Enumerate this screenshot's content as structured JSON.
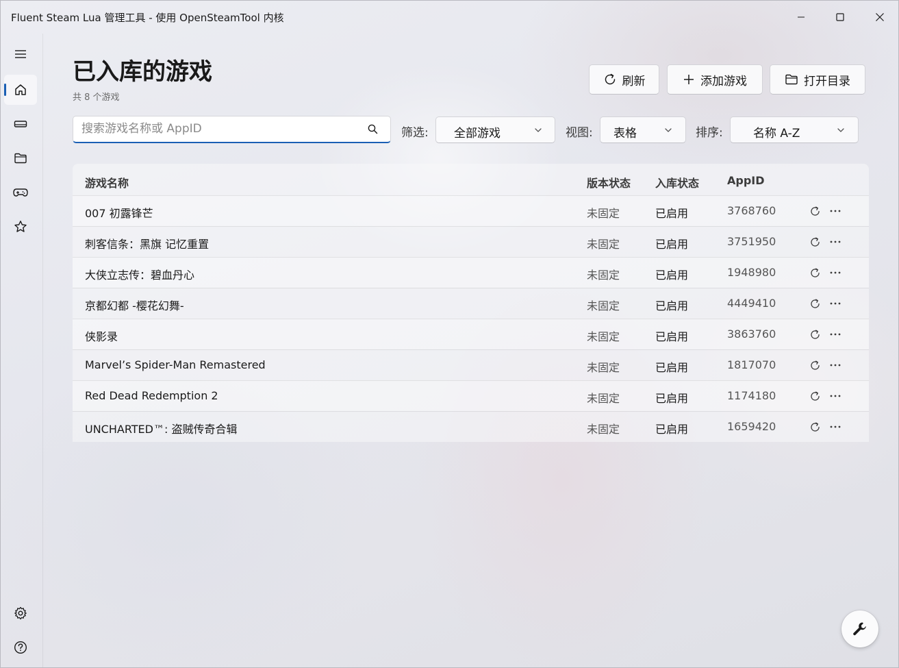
{
  "window": {
    "title": "Fluent Steam Lua 管理工具 - 使用 OpenSteamTool 内核"
  },
  "header": {
    "title": "已入库的游戏",
    "subtitle": "共 8 个游戏",
    "buttons": {
      "refresh": "刷新",
      "add_game": "添加游戏",
      "open_dir": "打开目录"
    }
  },
  "filters": {
    "search_placeholder": "搜索游戏名称或 AppID",
    "filter_label": "筛选:",
    "filter_value": "全部游戏",
    "view_label": "视图:",
    "view_value": "表格",
    "sort_label": "排序:",
    "sort_value": "名称 A-Z"
  },
  "table": {
    "columns": {
      "name": "游戏名称",
      "version": "版本状态",
      "status": "入库状态",
      "appid": "AppID"
    },
    "rows": [
      {
        "name": "007 初露锋芒",
        "version": "未固定",
        "status": "已启用",
        "appid": "3768760"
      },
      {
        "name": "刺客信条：黑旗 记忆重置",
        "version": "未固定",
        "status": "已启用",
        "appid": "3751950"
      },
      {
        "name": "大侠立志传：碧血丹心",
        "version": "未固定",
        "status": "已启用",
        "appid": "1948980"
      },
      {
        "name": "京都幻都 -樱花幻舞-",
        "version": "未固定",
        "status": "已启用",
        "appid": "4449410"
      },
      {
        "name": "侠影录",
        "version": "未固定",
        "status": "已启用",
        "appid": "3863760"
      },
      {
        "name": "Marvel’s Spider-Man Remastered",
        "version": "未固定",
        "status": "已启用",
        "appid": "1817070"
      },
      {
        "name": "Red Dead Redemption 2",
        "version": "未固定",
        "status": "已启用",
        "appid": "1174180"
      },
      {
        "name": "UNCHARTED™: 盗贼传奇合辑",
        "version": "未固定",
        "status": "已启用",
        "appid": "1659420"
      }
    ]
  },
  "icons": {
    "hamburger": "hamburger-icon",
    "home": "home-icon",
    "drive": "drive-icon",
    "folder": "folder-icon",
    "gamepad": "gamepad-icon",
    "star": "star-icon",
    "settings": "gear-icon",
    "help": "help-icon",
    "fab": "wrench-icon"
  },
  "colors": {
    "accent": "#1a5fb4"
  }
}
